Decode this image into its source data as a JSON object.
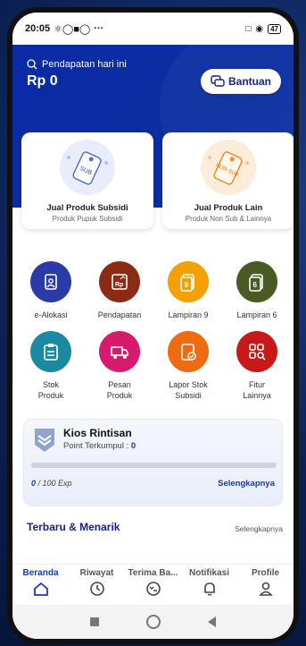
{
  "status_bar": {
    "time": "20:05",
    "extra": "···",
    "battery": "47"
  },
  "header": {
    "income_label": "Pendapatan hari ini",
    "income_value": "Rp 0",
    "help_label": "Bantuan"
  },
  "cards": [
    {
      "tag": "SUB",
      "title": "Jual Produk Subsidi",
      "subtitle": "Produk Pupuk Subsidi"
    },
    {
      "tag": "NON SUB",
      "title": "Jual Produk Lain",
      "subtitle": "Produk Non Sub & Lainnya"
    }
  ],
  "menu": [
    {
      "label": "e-Alokasi",
      "color": "#2a3aa6",
      "icon": "document-user-icon"
    },
    {
      "label": "Pendapatan",
      "color": "#8c2b14",
      "icon": "income-chart-icon"
    },
    {
      "label": "Lampiran 9",
      "color": "#f2a100",
      "icon": "attachment-9-icon"
    },
    {
      "label": "Lampiran 6",
      "color": "#4a5a23",
      "icon": "attachment-6-icon"
    },
    {
      "label": "Stok\nProduk",
      "color": "#1b8aa0",
      "icon": "clipboard-icon"
    },
    {
      "label": "Pesan\nProduk",
      "color": "#d61a6e",
      "icon": "truck-icon"
    },
    {
      "label": "Lapor Stok\nSubsidi",
      "color": "#ef6a10",
      "icon": "report-check-icon"
    },
    {
      "label": "Fitur\nLainnya",
      "color": "#c81818",
      "icon": "grid-search-icon"
    }
  ],
  "level": {
    "title": "Kios Rintisan",
    "points_label": "Point Terkumpul :",
    "points": "0",
    "exp_current": "0",
    "exp_total": "/ 100 Exp",
    "progress": 0,
    "more": "Selengkapnya"
  },
  "section": {
    "title": "Terbaru & Menarik",
    "more": "Selengkapnya"
  },
  "nav": [
    {
      "label": "Beranda",
      "icon": "home-icon",
      "active": true
    },
    {
      "label": "Riwayat",
      "icon": "clock-icon",
      "active": false
    },
    {
      "label": "Terima Ba...",
      "icon": "receive-icon",
      "active": false
    },
    {
      "label": "Notifikasi",
      "icon": "bell-icon",
      "active": false
    },
    {
      "label": "Profile",
      "icon": "user-icon",
      "active": false
    }
  ],
  "colors": {
    "primary": "#1a3aa6",
    "header": "#0b2aa8",
    "accent_orange": "#f28c28"
  }
}
